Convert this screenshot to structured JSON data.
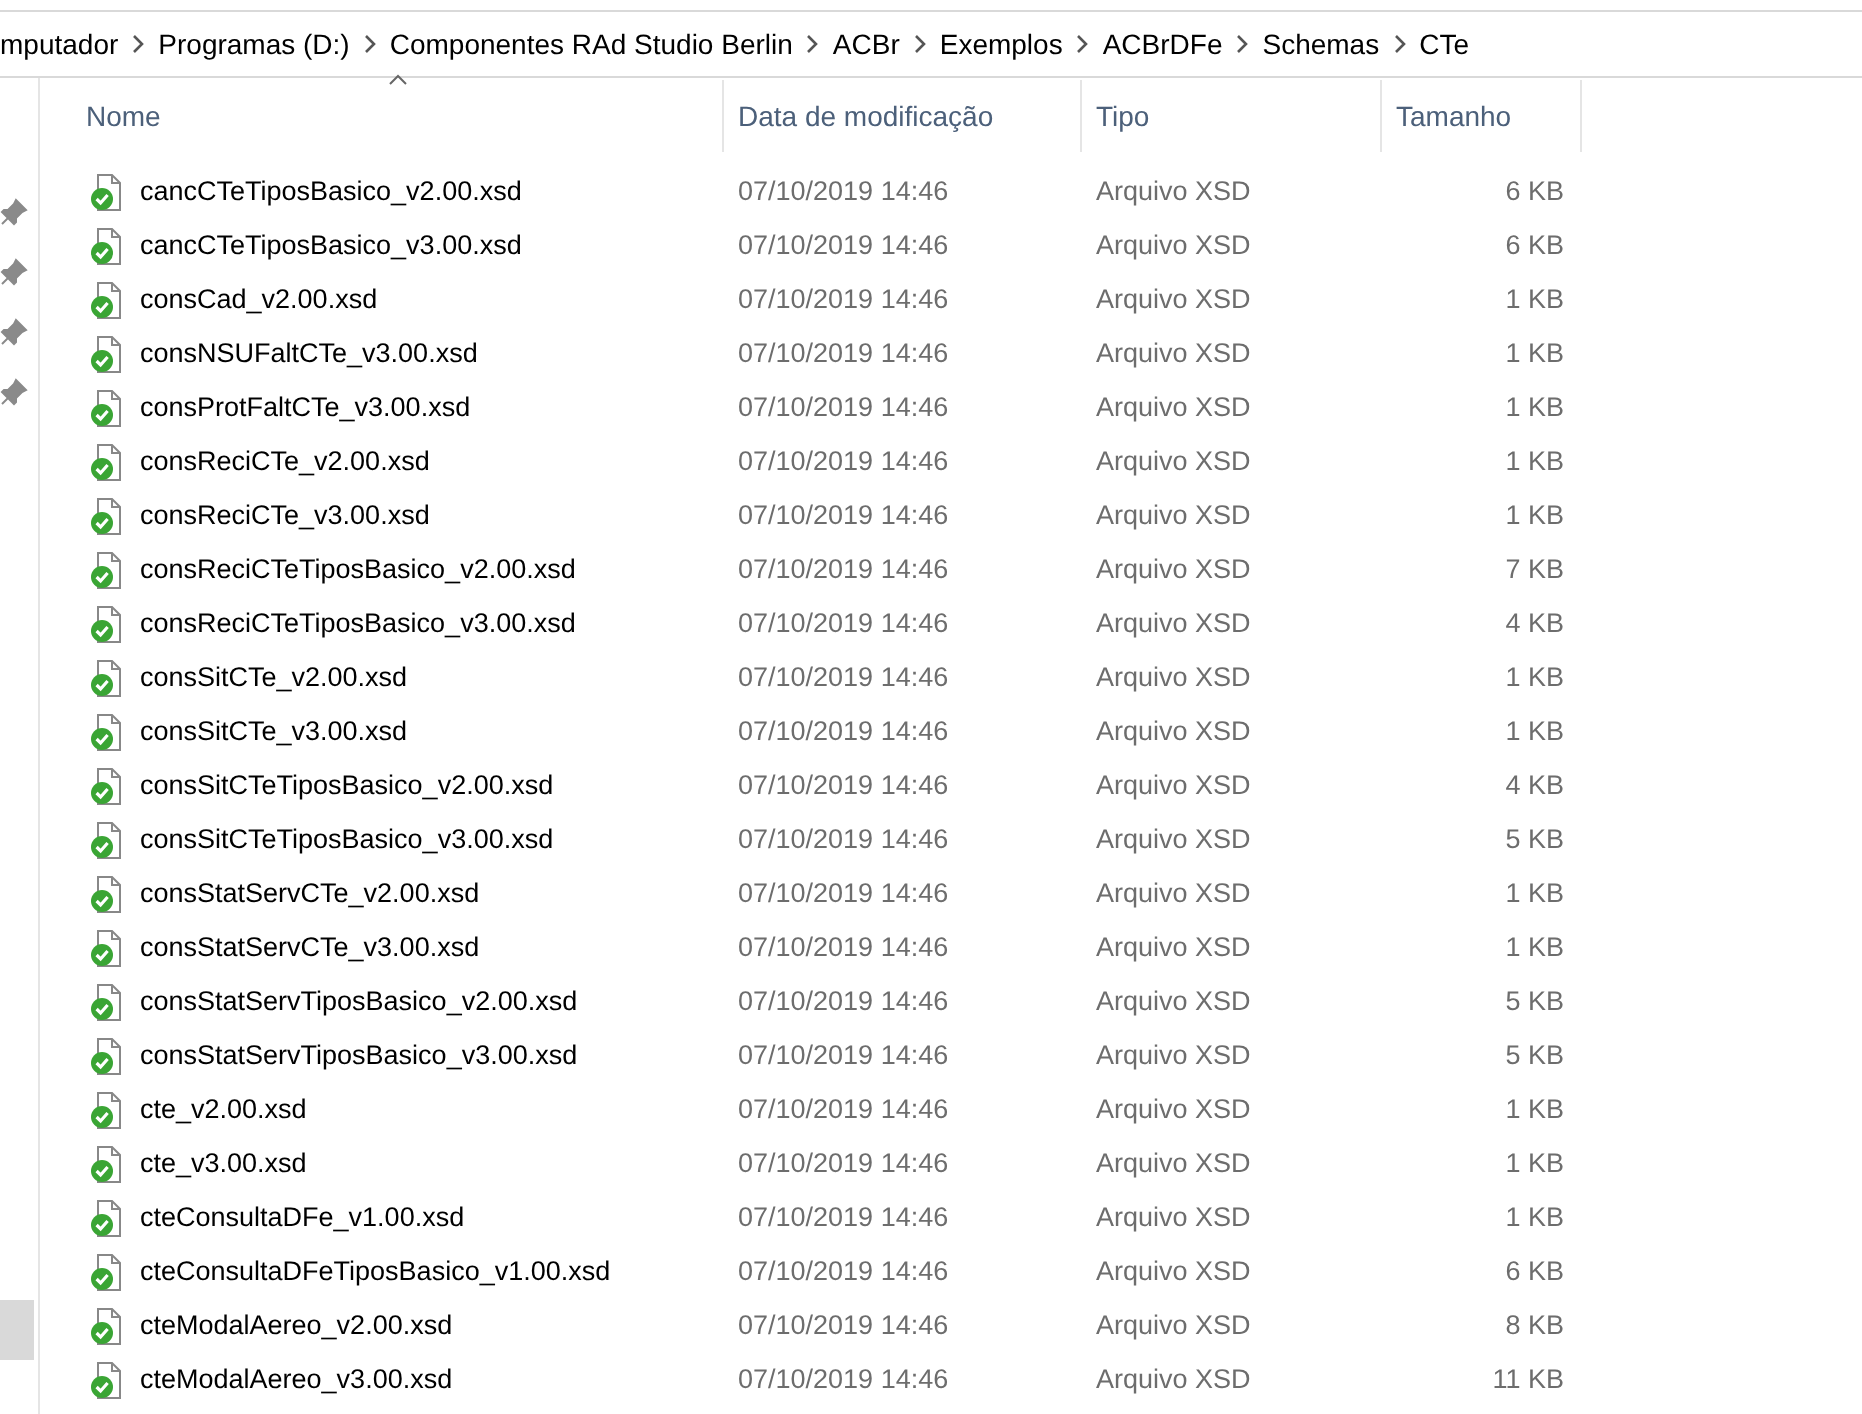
{
  "breadcrumb": [
    "mputador",
    "Programas (D:)",
    "Componentes RAd Studio Berlin",
    "ACBr",
    "Exemplos",
    "ACBrDFe",
    "Schemas",
    "CTe"
  ],
  "columns": [
    {
      "label": "Nome",
      "sorted": true
    },
    {
      "label": "Data de modificação",
      "sorted": false
    },
    {
      "label": "Tipo",
      "sorted": false
    },
    {
      "label": "Tamanho",
      "sorted": false
    }
  ],
  "files": [
    {
      "name": "cancCTeTiposBasico_v2.00.xsd",
      "modified": "07/10/2019 14:46",
      "type": "Arquivo XSD",
      "size": "6 KB"
    },
    {
      "name": "cancCTeTiposBasico_v3.00.xsd",
      "modified": "07/10/2019 14:46",
      "type": "Arquivo XSD",
      "size": "6 KB"
    },
    {
      "name": "consCad_v2.00.xsd",
      "modified": "07/10/2019 14:46",
      "type": "Arquivo XSD",
      "size": "1 KB"
    },
    {
      "name": "consNSUFaltCTe_v3.00.xsd",
      "modified": "07/10/2019 14:46",
      "type": "Arquivo XSD",
      "size": "1 KB"
    },
    {
      "name": "consProtFaltCTe_v3.00.xsd",
      "modified": "07/10/2019 14:46",
      "type": "Arquivo XSD",
      "size": "1 KB"
    },
    {
      "name": "consReciCTe_v2.00.xsd",
      "modified": "07/10/2019 14:46",
      "type": "Arquivo XSD",
      "size": "1 KB"
    },
    {
      "name": "consReciCTe_v3.00.xsd",
      "modified": "07/10/2019 14:46",
      "type": "Arquivo XSD",
      "size": "1 KB"
    },
    {
      "name": "consReciCTeTiposBasico_v2.00.xsd",
      "modified": "07/10/2019 14:46",
      "type": "Arquivo XSD",
      "size": "7 KB"
    },
    {
      "name": "consReciCTeTiposBasico_v3.00.xsd",
      "modified": "07/10/2019 14:46",
      "type": "Arquivo XSD",
      "size": "4 KB"
    },
    {
      "name": "consSitCTe_v2.00.xsd",
      "modified": "07/10/2019 14:46",
      "type": "Arquivo XSD",
      "size": "1 KB"
    },
    {
      "name": "consSitCTe_v3.00.xsd",
      "modified": "07/10/2019 14:46",
      "type": "Arquivo XSD",
      "size": "1 KB"
    },
    {
      "name": "consSitCTeTiposBasico_v2.00.xsd",
      "modified": "07/10/2019 14:46",
      "type": "Arquivo XSD",
      "size": "4 KB"
    },
    {
      "name": "consSitCTeTiposBasico_v3.00.xsd",
      "modified": "07/10/2019 14:46",
      "type": "Arquivo XSD",
      "size": "5 KB"
    },
    {
      "name": "consStatServCTe_v2.00.xsd",
      "modified": "07/10/2019 14:46",
      "type": "Arquivo XSD",
      "size": "1 KB"
    },
    {
      "name": "consStatServCTe_v3.00.xsd",
      "modified": "07/10/2019 14:46",
      "type": "Arquivo XSD",
      "size": "1 KB"
    },
    {
      "name": "consStatServTiposBasico_v2.00.xsd",
      "modified": "07/10/2019 14:46",
      "type": "Arquivo XSD",
      "size": "5 KB"
    },
    {
      "name": "consStatServTiposBasico_v3.00.xsd",
      "modified": "07/10/2019 14:46",
      "type": "Arquivo XSD",
      "size": "5 KB"
    },
    {
      "name": "cte_v2.00.xsd",
      "modified": "07/10/2019 14:46",
      "type": "Arquivo XSD",
      "size": "1 KB"
    },
    {
      "name": "cte_v3.00.xsd",
      "modified": "07/10/2019 14:46",
      "type": "Arquivo XSD",
      "size": "1 KB"
    },
    {
      "name": "cteConsultaDFe_v1.00.xsd",
      "modified": "07/10/2019 14:46",
      "type": "Arquivo XSD",
      "size": "1 KB"
    },
    {
      "name": "cteConsultaDFeTiposBasico_v1.00.xsd",
      "modified": "07/10/2019 14:46",
      "type": "Arquivo XSD",
      "size": "6 KB"
    },
    {
      "name": "cteModalAereo_v2.00.xsd",
      "modified": "07/10/2019 14:46",
      "type": "Arquivo XSD",
      "size": "8 KB"
    },
    {
      "name": "cteModalAereo_v3.00.xsd",
      "modified": "07/10/2019 14:46",
      "type": "Arquivo XSD",
      "size": "11 KB"
    }
  ]
}
